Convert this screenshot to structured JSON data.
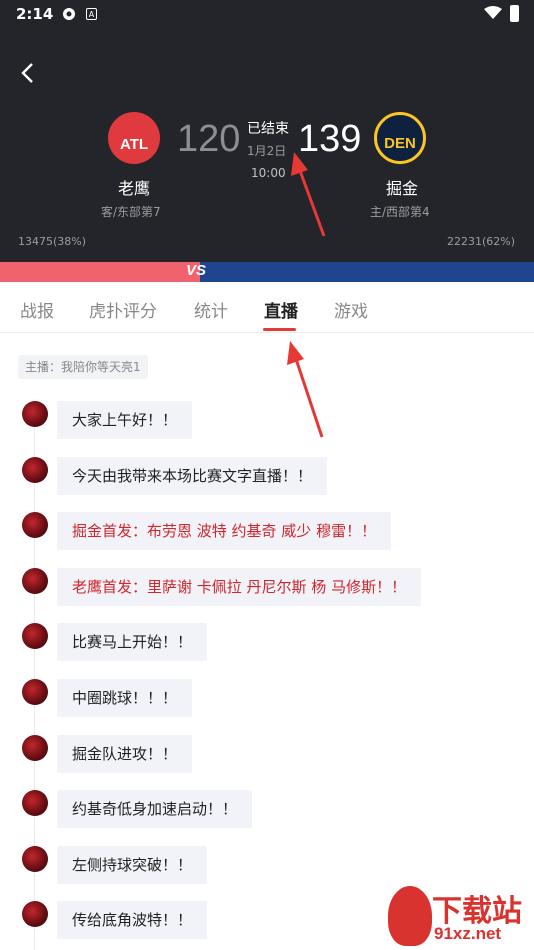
{
  "status_bar": {
    "time": "2:14"
  },
  "game": {
    "status": "已结束",
    "date": "1月2日",
    "time": "10:00",
    "away": {
      "logo_text": "ATL",
      "name": "老鹰",
      "score": "120",
      "rank": "客/东部第7",
      "votes": "13475(38%)",
      "color": "#e03a3e"
    },
    "home": {
      "logo_text": "DEN",
      "name": "掘金",
      "score": "139",
      "rank": "主/西部第4",
      "votes": "22231(62%)",
      "color": "#0e2240"
    }
  },
  "vs_label": "VS",
  "tabs": [
    {
      "label": "战报",
      "active": false
    },
    {
      "label": "虎扑评分",
      "active": false
    },
    {
      "label": "统计",
      "active": false
    },
    {
      "label": "直播",
      "active": true
    },
    {
      "label": "游戏",
      "active": false
    }
  ],
  "anchor_label": "主播：我陪你等天亮1",
  "messages": [
    {
      "text": "大家上午好！！",
      "highlight": false
    },
    {
      "text": "今天由我带来本场比赛文字直播！！",
      "highlight": false
    },
    {
      "text": "掘金首发：布劳恩 波特 约基奇 威少 穆雷！！",
      "highlight": true
    },
    {
      "text": "老鹰首发：里萨谢 卡佩拉 丹尼尔斯 杨 马修斯！！",
      "highlight": true
    },
    {
      "text": "比赛马上开始！！",
      "highlight": false
    },
    {
      "text": "中圈跳球！！！",
      "highlight": false
    },
    {
      "text": "掘金队进攻！！",
      "highlight": false
    },
    {
      "text": "约基奇低身加速启动！！",
      "highlight": false
    },
    {
      "text": "左侧持球突破！！",
      "highlight": false
    },
    {
      "text": "传给底角波特！！",
      "highlight": false
    }
  ],
  "watermark": {
    "main": "下载站",
    "site": "91xz.net"
  },
  "colors": {
    "header_bg": "#24252a",
    "accent_red": "#e53935",
    "highlight_text": "#d0262c",
    "bubble_bg": "#f1f3f8"
  }
}
